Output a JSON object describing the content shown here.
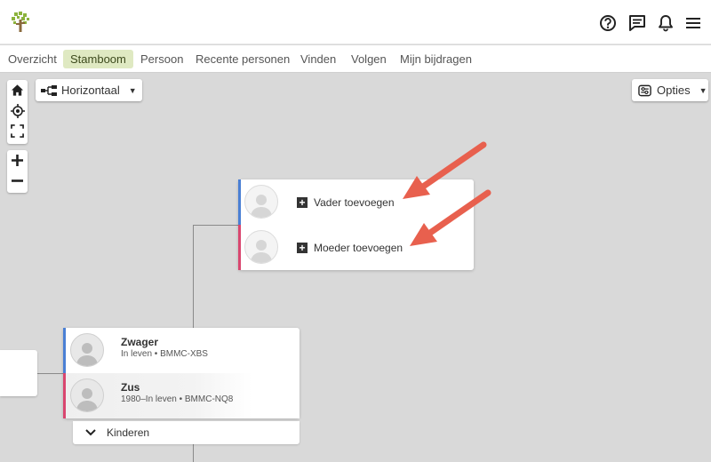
{
  "header": {
    "logo": "family-tree-logo",
    "icons": [
      "help-icon",
      "messages-icon",
      "notifications-icon",
      "menu-icon"
    ]
  },
  "nav": {
    "tabs": [
      "Overzicht",
      "Stamboom",
      "Persoon",
      "Recente personen",
      "Vinden",
      "Volgen",
      "Mijn bijdragen"
    ],
    "active": "Stamboom"
  },
  "toolbar": {
    "layout_label": "Horizontaal",
    "options_label": "Opties",
    "map_controls": [
      "home-icon",
      "locate-icon",
      "fullscreen-icon"
    ],
    "zoom_controls": [
      "zoom-in-icon",
      "zoom-out-icon"
    ]
  },
  "parents": {
    "add_father_label": "Vader toevoegen",
    "add_mother_label": "Moeder toevoegen"
  },
  "couple": {
    "husband": {
      "name": "Zwager",
      "details": "In leven • BMMC-XBS"
    },
    "wife": {
      "name": "Zus",
      "details": "1980–In leven • BMMC-NQ8"
    },
    "children_label": "Kinderen"
  },
  "colors": {
    "male": "#4a7fd4",
    "female": "#d9466f",
    "active_tab_bg": "#dfe9c2",
    "logo_green": "#8cb33d",
    "arrow": "#e8604e",
    "canvas_bg": "#d9d9d9"
  }
}
